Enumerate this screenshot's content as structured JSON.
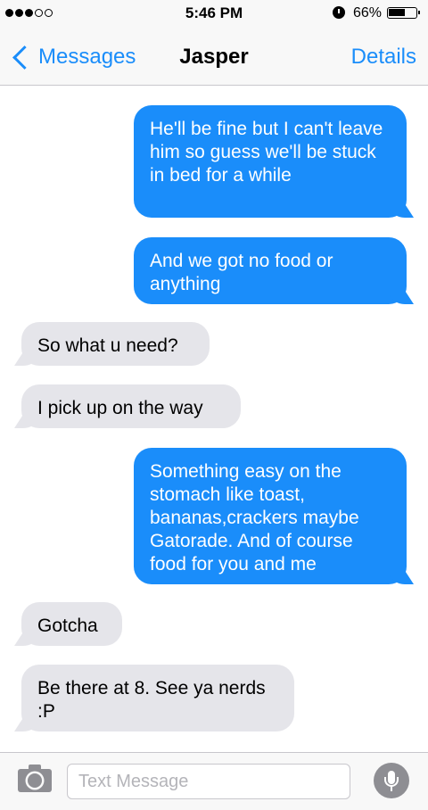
{
  "status_bar": {
    "signal_dots": 5,
    "signal_strength": 3,
    "time": "5:46 PM",
    "alarm_icon": "alarm-clock-icon",
    "battery_percent_label": "66%",
    "battery_level": 0.66
  },
  "nav": {
    "back_label": "Messages",
    "contact_name": "Jasper",
    "details_label": "Details"
  },
  "messages": [
    {
      "direction": "sent",
      "text": "He'll be fine but I can't leave him so guess we'll be stuck in bed for a while"
    },
    {
      "direction": "sent",
      "text": "And we got no food or anything"
    },
    {
      "direction": "received",
      "text": "So what u need?"
    },
    {
      "direction": "received",
      "text": "I pick up on the way"
    },
    {
      "direction": "sent",
      "text": "Something easy on the stomach like toast, bananas,crackers maybe Gatorade. And of course food for you and me"
    },
    {
      "direction": "received",
      "text": "Gotcha"
    },
    {
      "direction": "received",
      "text": "Be there at 8. See ya nerds :P"
    }
  ],
  "input_bar": {
    "placeholder": "Text Message",
    "value": "",
    "camera_icon": "camera-icon",
    "mic_icon": "microphone-icon"
  },
  "colors": {
    "accent": "#1a8dfa",
    "sent_bubble": "#1a8dfa",
    "received_bubble": "#e5e5ea"
  }
}
